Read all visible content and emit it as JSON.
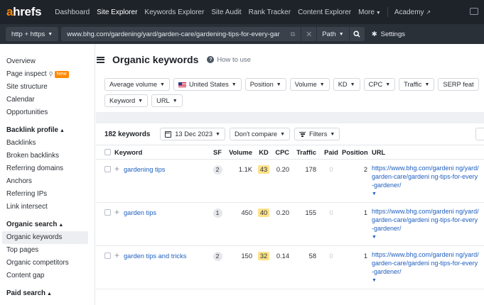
{
  "brand": {
    "prefix": "a",
    "rest": "hrefs",
    "accent": "#ff8800"
  },
  "nav": {
    "items": [
      "Dashboard",
      "Site Explorer",
      "Keywords Explorer",
      "Site Audit",
      "Rank Tracker",
      "Content Explorer"
    ],
    "active": "Site Explorer",
    "more": "More",
    "academy": "Academy"
  },
  "urlbar": {
    "protocol": "http + https",
    "url": "www.bhg.com/gardening/yard/garden-care/gardening-tips-for-every-gar",
    "mode": "Path",
    "settings": "Settings"
  },
  "sidebar": {
    "top": [
      "Overview",
      "Page inspect",
      "Site structure",
      "Calendar",
      "Opportunities"
    ],
    "new_badge": "New",
    "backlink_head": "Backlink profile",
    "backlink": [
      "Backlinks",
      "Broken backlinks",
      "Referring domains",
      "Anchors",
      "Referring IPs",
      "Link intersect"
    ],
    "organic_head": "Organic search",
    "organic": [
      "Organic keywords",
      "Top pages",
      "Organic competitors",
      "Content gap"
    ],
    "paid_head": "Paid search"
  },
  "page": {
    "title": "Organic keywords",
    "howto": "How to use"
  },
  "filters": {
    "row1": [
      "Average volume",
      "United States",
      "Position",
      "Volume",
      "KD",
      "CPC",
      "Traffic",
      "SERP feat"
    ],
    "row2": [
      "Keyword",
      "URL"
    ]
  },
  "toolbar": {
    "count": "182 keywords",
    "date": "13 Dec 2023",
    "compare": "Don't compare",
    "filters": "Filters"
  },
  "table": {
    "headers": [
      "Keyword",
      "SF",
      "Volume",
      "KD",
      "CPC",
      "Traffic",
      "Paid",
      "Position",
      "URL"
    ],
    "rows": [
      {
        "keyword": "gardening tips",
        "sf": "2",
        "volume": "1.1K",
        "kd": "43",
        "cpc": "0.20",
        "traffic": "178",
        "paid": "0",
        "position": "2",
        "url": "https://www.bhg.com/gardeni ng/yard/garden-care/gardeni ng-tips-for-every-gardener/"
      },
      {
        "keyword": "garden tips",
        "sf": "1",
        "volume": "450",
        "kd": "40",
        "cpc": "0.20",
        "traffic": "155",
        "paid": "0",
        "position": "1",
        "url": "https://www.bhg.com/gardeni ng/yard/garden-care/gardeni ng-tips-for-every-gardener/"
      },
      {
        "keyword": "garden tips and tricks",
        "sf": "2",
        "volume": "150",
        "kd": "32",
        "cpc": "0.14",
        "traffic": "58",
        "paid": "0",
        "position": "1",
        "url": "https://www.bhg.com/gardeni ng/yard/garden-care/gardeni ng-tips-for-every-gardener/"
      }
    ]
  }
}
